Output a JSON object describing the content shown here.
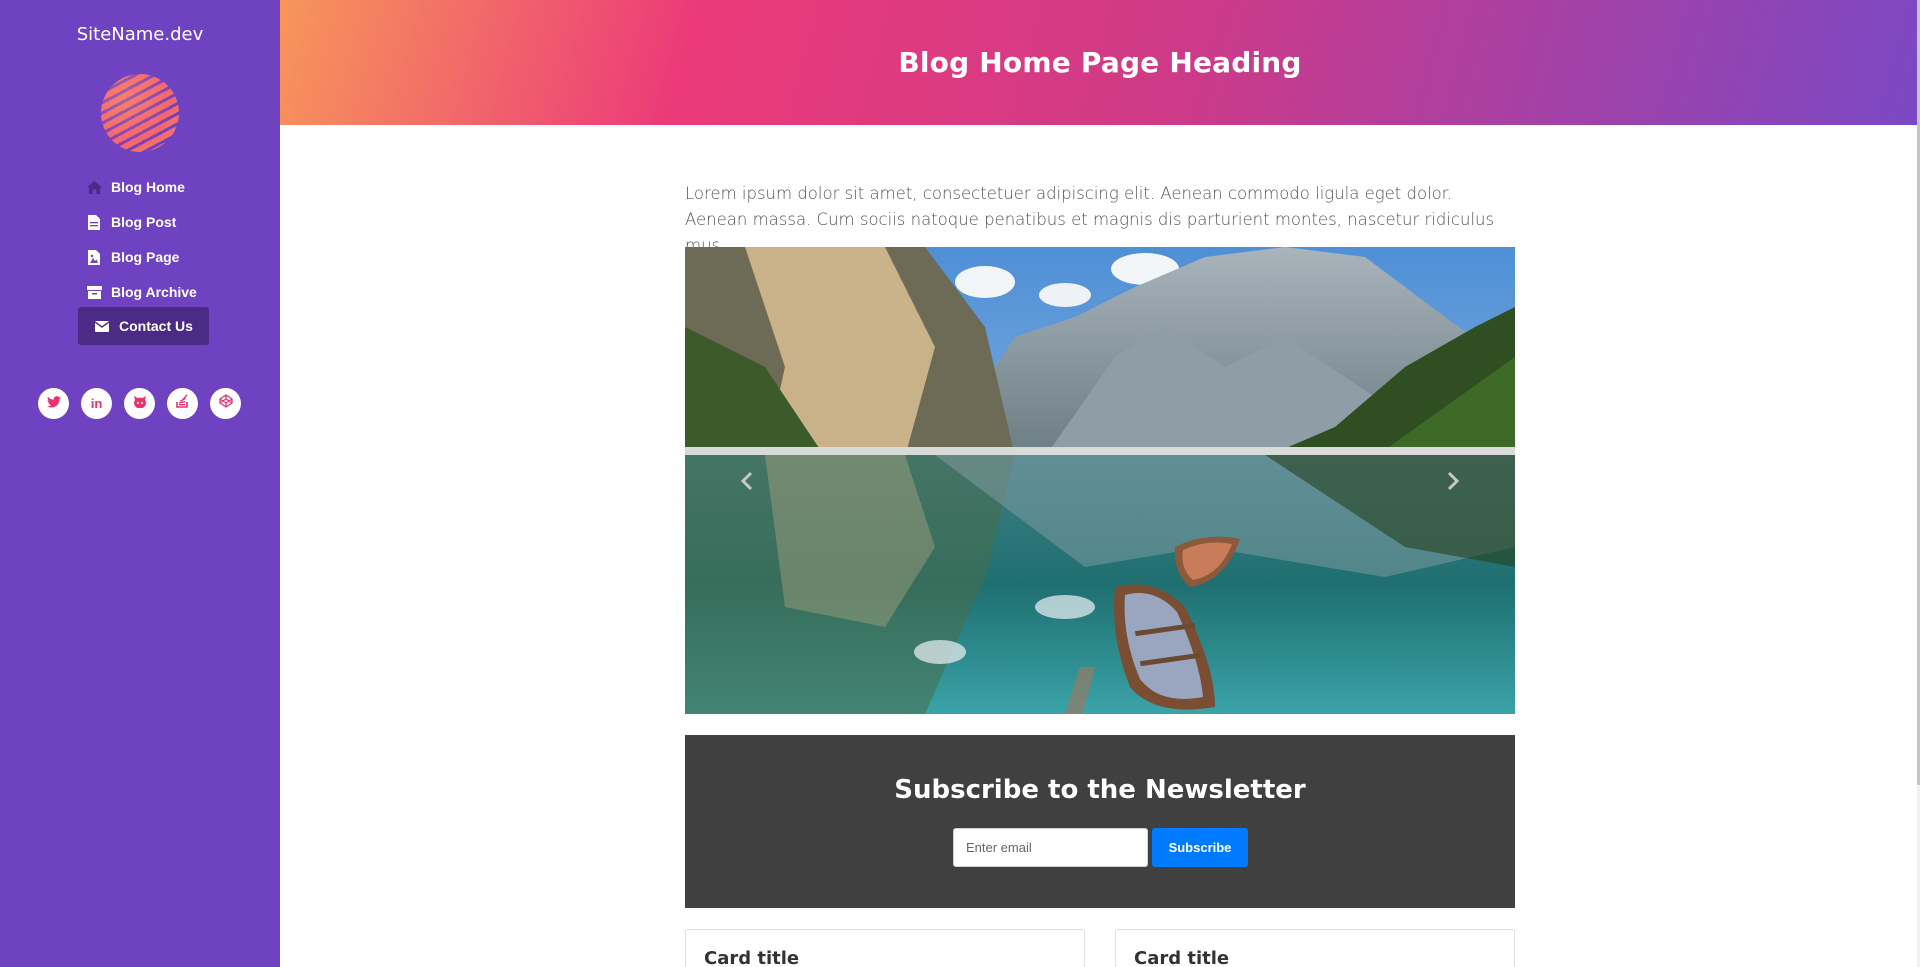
{
  "sidebar": {
    "site_name": "SiteName.dev",
    "nav": [
      {
        "label": "Blog Home",
        "icon": "home-icon"
      },
      {
        "label": "Blog Post",
        "icon": "file-icon"
      },
      {
        "label": "Blog Page",
        "icon": "file-image-icon"
      },
      {
        "label": "Blog Archive",
        "icon": "archive-icon"
      },
      {
        "label": "Contact Us",
        "icon": "envelope-icon",
        "active": true
      }
    ],
    "socials": [
      "twitter-icon",
      "linkedin-icon",
      "github-icon",
      "stack-overflow-icon",
      "codepen-icon"
    ]
  },
  "header": {
    "title": "Blog Home Page Heading"
  },
  "main": {
    "intro": "Lorem ipsum dolor sit amet, consectetuer adipiscing elit. Aenean commodo ligula eget dolor. Aenean massa. Cum sociis natoque penatibus et magnis dis parturient montes, nascetur ridiculus mus.",
    "carousel": {
      "prev_icon": "chevron-left-icon",
      "next_icon": "chevron-right-icon"
    },
    "newsletter": {
      "title": "Subscribe to the Newsletter",
      "email_placeholder": "Enter email",
      "button_label": "Subscribe"
    },
    "cards": [
      {
        "title": "Card title"
      },
      {
        "title": "Card title"
      }
    ]
  },
  "colors": {
    "sidebar_bg": "#6f42c1",
    "active_nav_bg": "#4b2b86",
    "social_icon": "#e8336f",
    "newsletter_bg": "#404040",
    "button_primary": "#007bff"
  }
}
